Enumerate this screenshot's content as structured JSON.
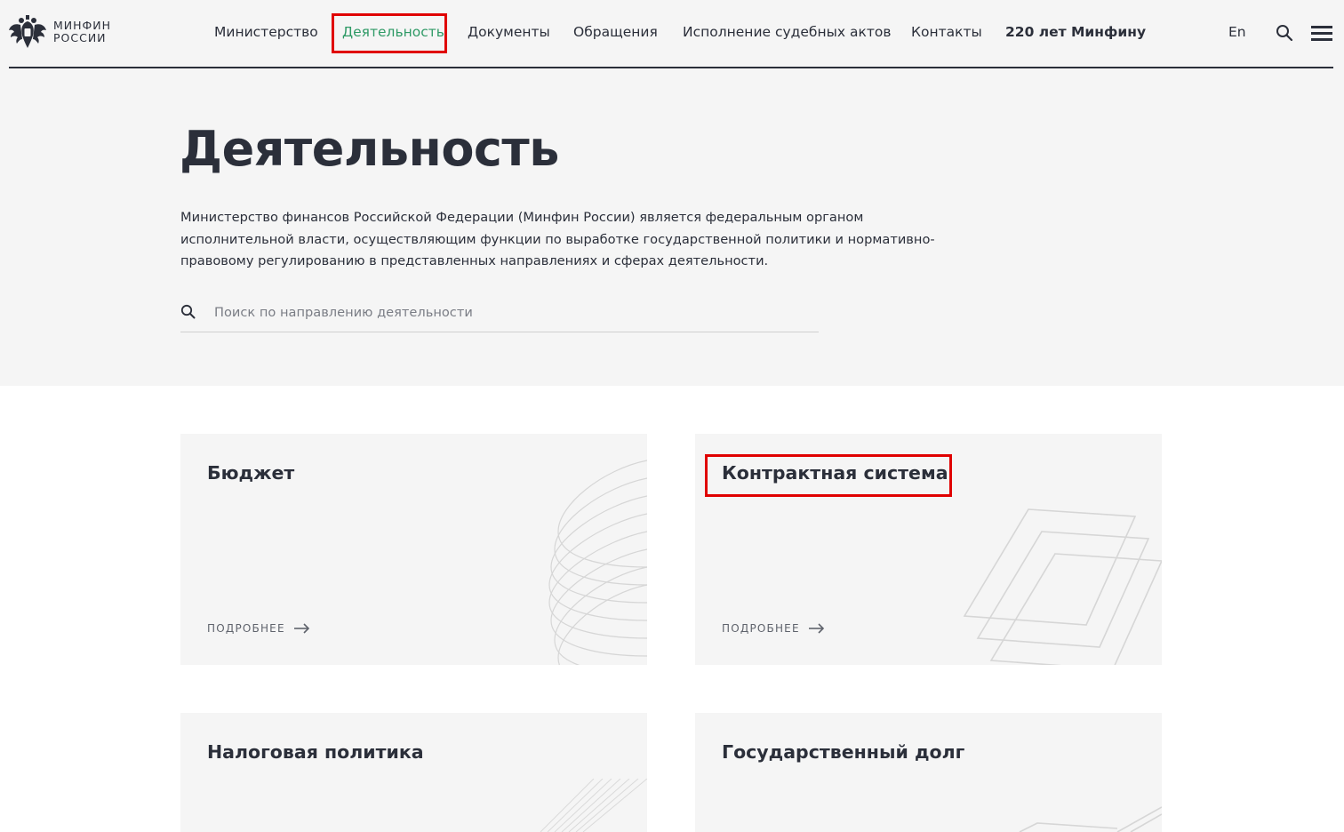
{
  "header": {
    "logo_line1": "МИНФИН",
    "logo_line2": "РОССИИ",
    "nav": [
      {
        "label": "Министерство"
      },
      {
        "label": "Деятельность",
        "active": true
      },
      {
        "label": "Документы"
      },
      {
        "label": "Обращения"
      },
      {
        "label": "Исполнение судебных актов"
      },
      {
        "label": "Контакты"
      },
      {
        "label": "220 лет Минфину"
      }
    ],
    "lang": "En",
    "icons": {
      "search": "search-icon",
      "menu": "hamburger-menu-icon",
      "logo": "double-headed-eagle-icon"
    }
  },
  "hero": {
    "title": "Деятельность",
    "intro": "Министерство финансов Российской Федерации (Минфин России) является федеральным органом исполнительной власти, осуществляющим функции по выработке государственной политики и нормативно-правовому регулированию в представленных направлениях и сферах деятельности.",
    "search_placeholder": "Поиск по направлению деятельности",
    "search_value": ""
  },
  "cards": [
    {
      "title": "Бюджет",
      "more": "ПОДРОБНЕЕ"
    },
    {
      "title": "Контрактная система",
      "more": "ПОДРОБНЕЕ"
    },
    {
      "title": "Налоговая политика"
    },
    {
      "title": "Государственный долг"
    }
  ],
  "colors": {
    "text": "#2b2f3a",
    "active_nav": "#2f9a66",
    "highlight": "#e00000",
    "background": "#f5f5f5"
  }
}
